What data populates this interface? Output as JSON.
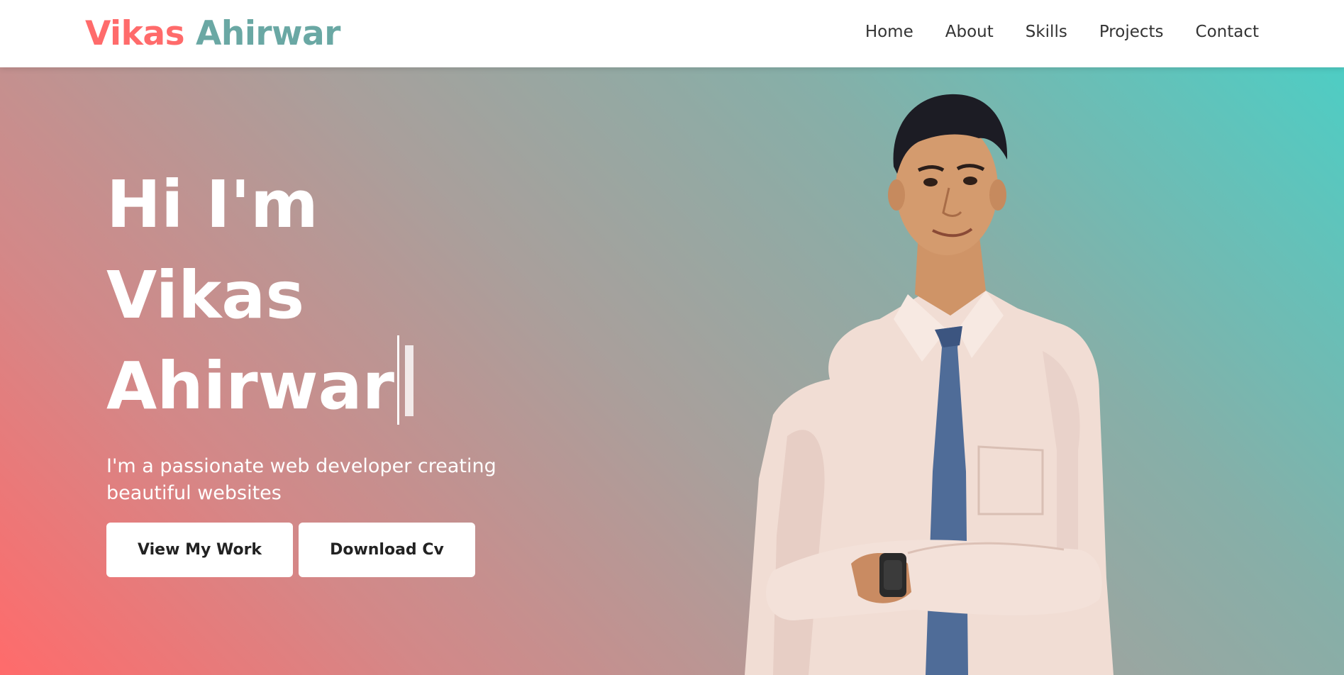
{
  "nav": {
    "logo_first": "Vikas",
    "logo_last": "Ahirwar",
    "links": [
      "Home",
      "About",
      "Skills",
      "Projects",
      "Contact"
    ]
  },
  "hero": {
    "greeting": "Hi I'm",
    "name_first": "Vikas",
    "name_last": "Ahirwar",
    "subtitle": "I'm a passionate web developer creating beautiful websites",
    "buttons": {
      "primary": "View My Work",
      "secondary": "Download Cv"
    }
  },
  "colors": {
    "accent_red": "#ff6b6b",
    "accent_teal": "#4ecdc4",
    "logo_teal": "#6aa8a4",
    "text_dark": "#333333"
  },
  "icons": {
    "typing_cursor": "text-cursor-icon"
  }
}
